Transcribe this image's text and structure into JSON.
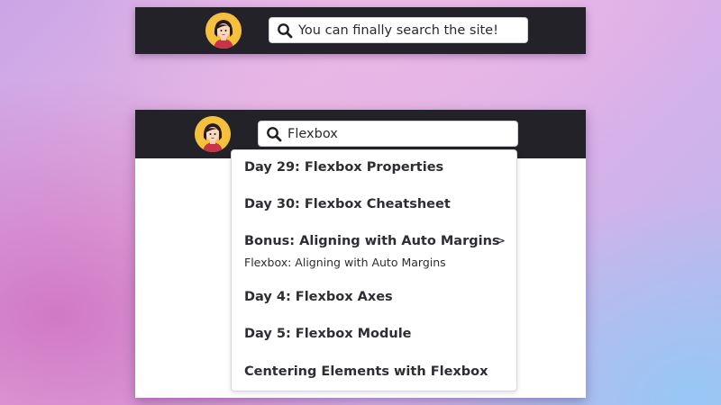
{
  "top_header": {
    "avatar_icon": "user-avatar-icon",
    "search": {
      "icon": "search-icon",
      "value": "You can finally search the site!"
    }
  },
  "bottom_header": {
    "avatar_icon": "user-avatar-icon",
    "search": {
      "icon": "search-icon",
      "value": "Flexbox"
    }
  },
  "search_results": [
    {
      "title": "Day 29: Flexbox Properties"
    },
    {
      "title": "Day 30: Flexbox Cheatsheet"
    },
    {
      "title": "Bonus: Aligning with Auto Margins",
      "arrow": ">",
      "subtitle": "Flexbox: Aligning with Auto Margins"
    },
    {
      "title": "Day 4: Flexbox Axes"
    },
    {
      "title": "Day 5: Flexbox Module"
    },
    {
      "title": "Centering Elements with Flexbox"
    }
  ],
  "colors": {
    "header_bg": "#232228",
    "avatar_bg": "#f4c03e",
    "text": "#2d2d33"
  }
}
